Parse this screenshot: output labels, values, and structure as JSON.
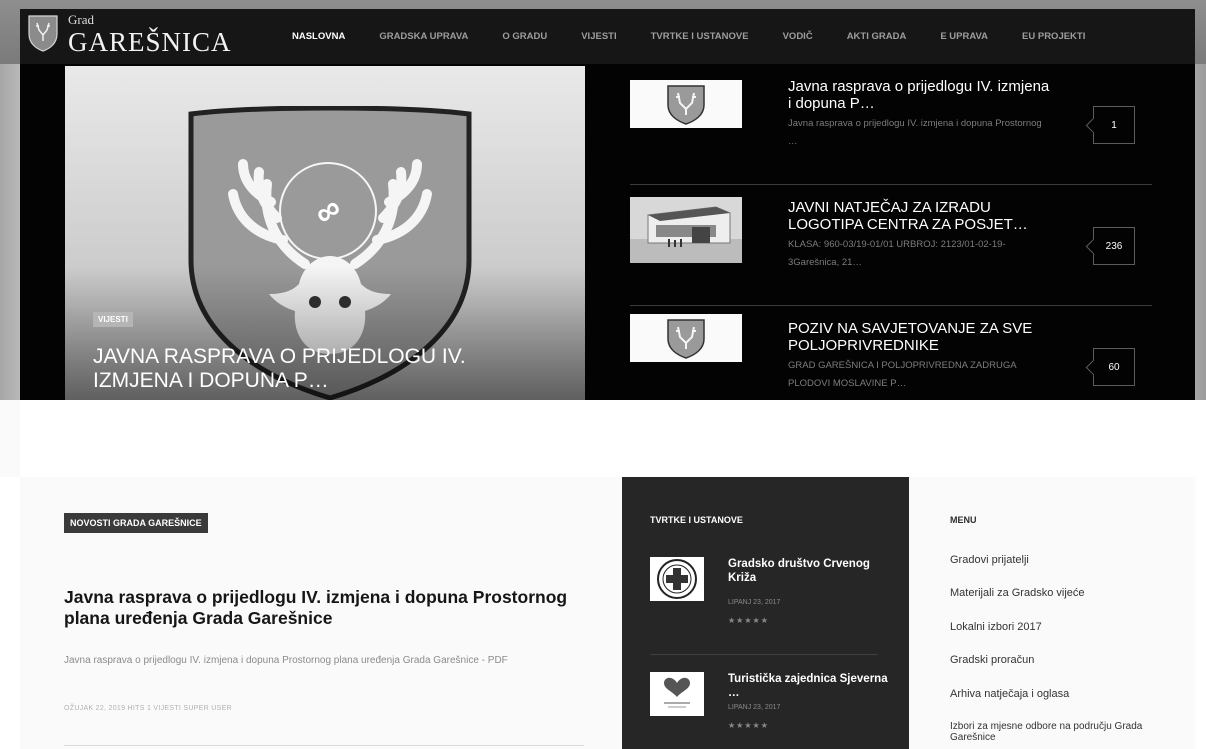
{
  "header": {
    "logo_small": "Grad",
    "logo_big": "GAREŠNICA",
    "nav": [
      "NASLOVNA",
      "GRADSKA UPRAVA",
      "O GRADU",
      "VIJESTI",
      "TVRTKE I USTANOVE",
      "VODIČ",
      "AKTI GRADA",
      "E UPRAVA",
      "EU PROJEKTI"
    ],
    "active_nav": "NASLOVNA"
  },
  "feature": {
    "tag": "VIJESTI",
    "title": "JAVNA RASPRAVA O PRIJEDLOGU IV. IZMJENA I DOPUNA P…"
  },
  "side_news": [
    {
      "title": "Javna rasprava o prijedlogu IV. izmjena i dopuna P…",
      "excerpt": "Javna rasprava o prijedlogu IV. izmjena i dopuna Prostornog …",
      "count": "1",
      "thumb": "coat-of-arms"
    },
    {
      "title": "JAVNI NATJEČAJ ZA IZRADU LOGOTIPA CENTRA ZA POSJET…",
      "excerpt": "KLASA: 960-03/19-01/01 URBROJ: 2123/01-02-19-3Garešnica, 21…",
      "count": "236",
      "thumb": "building-photo"
    },
    {
      "title": "POZIV NA SAVJETOVANJE ZA SVE POLJOPRIVREDNIKE",
      "excerpt": "GRAD GAREŠNICA I POLJOPRIVREDNA ZADRUGA PLODOVI MOSLAVINE P…",
      "count": "60",
      "thumb": "coat-of-arms"
    }
  ],
  "main": {
    "section_label": "NOVOSTI GRADA GAREŠNICE",
    "article_title": "Javna rasprava o prijedlogu IV. izmjena i dopuna Prostornog plana uređenja Grada Garešnice",
    "article_excerpt": "Javna rasprava o prijedlogu IV. izmjena i dopuna Prostornog plana uređenja Grada Garešnice - PDF",
    "article_meta": "OŽUJAK 22, 2019 HITS 1 VIJESTI SUPER USER"
  },
  "firms": {
    "title": "TVRTKE I USTANOVE",
    "items": [
      {
        "name": "Gradsko društvo Crvenog Križa",
        "date": "LIPANJ 23, 2017",
        "stars": "★★★★★",
        "thumb": "red-cross-logo"
      },
      {
        "name": "Turistička zajednica Sjeverna …",
        "date": "LIPANJ 23, 2017",
        "stars": "★★★★★",
        "thumb": "heart-logo"
      }
    ]
  },
  "menu": {
    "title": "MENU",
    "items": [
      "Gradovi prijatelji",
      "Materijali za Gradsko vijeće",
      "Lokalni izbori 2017",
      "Gradski proračun",
      "Arhiva natječaja i oglasa",
      "Izbori za mjesne odbore na području Grada Garešnice"
    ]
  }
}
